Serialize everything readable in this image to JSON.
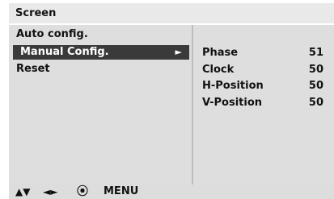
{
  "title": "Screen",
  "menu": {
    "items": [
      {
        "label": "Auto config."
      },
      {
        "label": "Manual Config.",
        "arrow": "►"
      },
      {
        "label": "Reset"
      }
    ]
  },
  "params": [
    {
      "name": "Phase",
      "value": "51"
    },
    {
      "name": "Clock",
      "value": "50"
    },
    {
      "name": "H-Position",
      "value": "50"
    },
    {
      "name": "V-Position",
      "value": "50"
    }
  ],
  "footer": {
    "updown": "▲▼",
    "leftright": "◄►",
    "select": "⦿",
    "menu_label": "MENU"
  },
  "colors": {
    "title_bg": "#e9e9e9",
    "panel_bg": "#dedede",
    "selected_bg": "#3a3a3a",
    "selected_fg": "#ffffff"
  }
}
